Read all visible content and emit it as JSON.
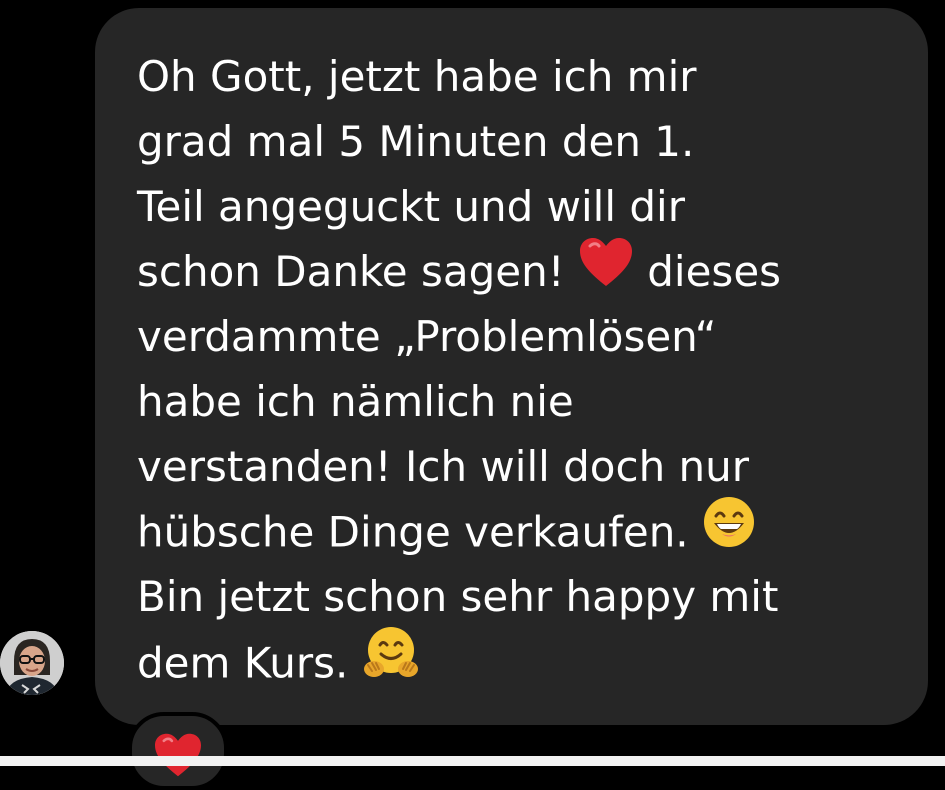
{
  "message": {
    "lines": [
      "Oh Gott, jetzt habe ich mir",
      "grad mal 5 Minuten den 1.",
      "Teil angeguckt und will dir",
      "schon Danke sagen!",
      "dieses",
      "verdammte „Problemlösen“",
      "habe ich nämlich nie",
      "verstanden! Ich will doch nur",
      "hübsche Dinge verkaufen.",
      "Bin jetzt schon sehr happy mit",
      "dem Kurs."
    ]
  },
  "emojis": {
    "heart": "red-heart-icon",
    "smile": "grinning-face-icon",
    "hug": "hugging-face-icon"
  },
  "reaction": {
    "icon": "red-heart-icon"
  },
  "colors": {
    "background": "#000000",
    "bubble": "#262626",
    "text": "#ffffff",
    "heart": "#e0252f",
    "emoji_yellow": "#f7c531"
  }
}
